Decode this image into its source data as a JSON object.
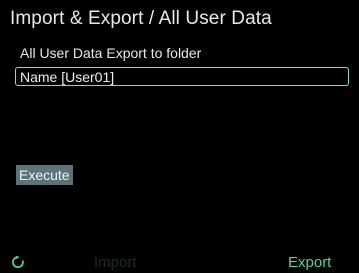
{
  "header": {
    "title": "Import & Export / All User Data"
  },
  "main": {
    "subtitle": "All User Data Export to folder",
    "name_field_value": "Name [User01]",
    "execute_label": "Execute"
  },
  "footer": {
    "refresh_icon": "refresh-icon",
    "import_label": "Import",
    "export_label": "Export"
  },
  "colors": {
    "background": "#000000",
    "text": "#e8e8e8",
    "accent_green": "#4fd39a",
    "field_border": "#7fe0b8",
    "execute_background": "#5b7477",
    "inactive_footer_text": "#1b2d28"
  }
}
